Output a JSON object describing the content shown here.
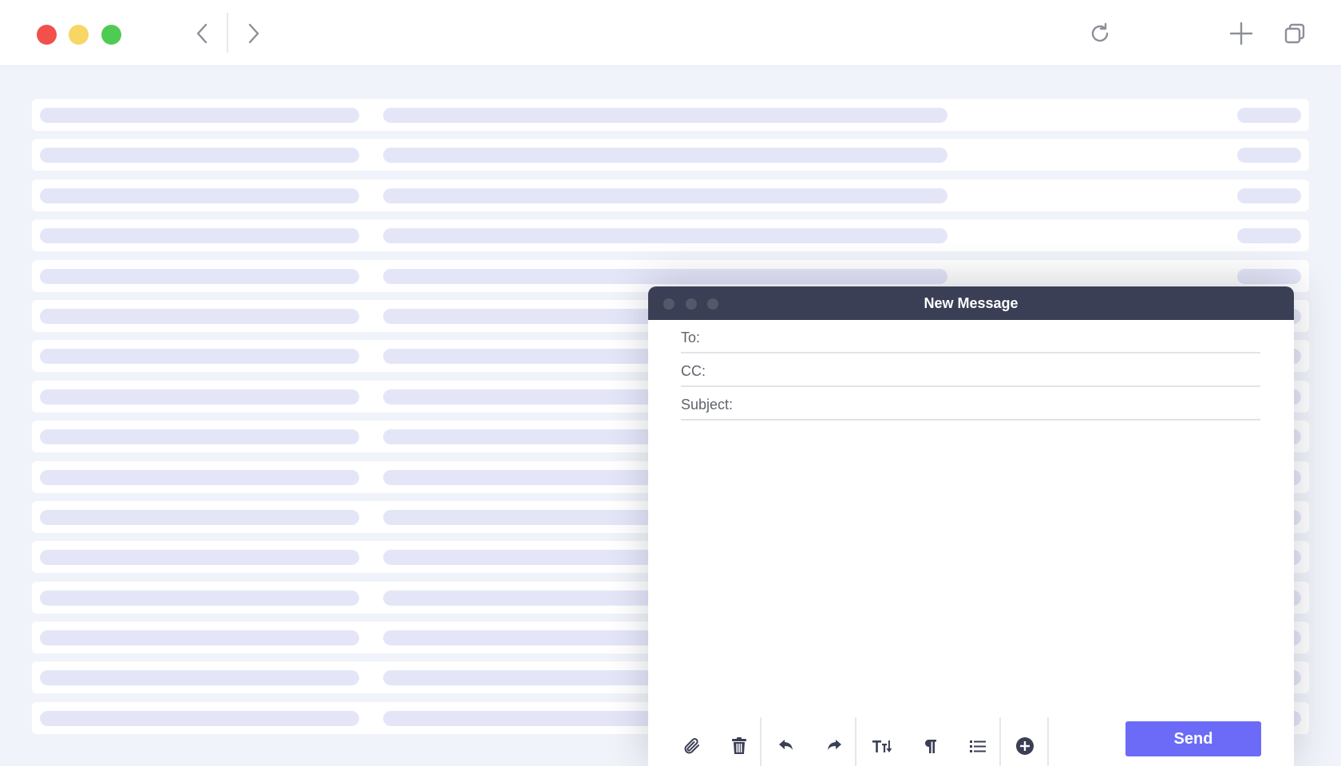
{
  "browser": {
    "traffic_lights": {
      "close_color": "#f2504b",
      "minimize_color": "#f7d664",
      "maximize_color": "#4fcb53"
    },
    "icons": [
      "chevron-left-icon",
      "chevron-right-icon",
      "reload-icon",
      "plus-icon",
      "tabs-icon"
    ]
  },
  "skeleton_rows": 16,
  "compose": {
    "title": "New Message",
    "to_label": "To:",
    "cc_label": "CC:",
    "subject_label": "Subject:",
    "to_value": "",
    "cc_value": "",
    "subject_value": "",
    "body_value": "",
    "send_label": "Send",
    "accent_color": "#6b6bf7",
    "header_color": "#3b3f55",
    "toolbar_icons": [
      "paperclip-icon",
      "trash-icon",
      "undo-icon",
      "redo-icon",
      "text-size-icon",
      "paragraph-icon",
      "list-icon",
      "add-circle-icon"
    ]
  }
}
